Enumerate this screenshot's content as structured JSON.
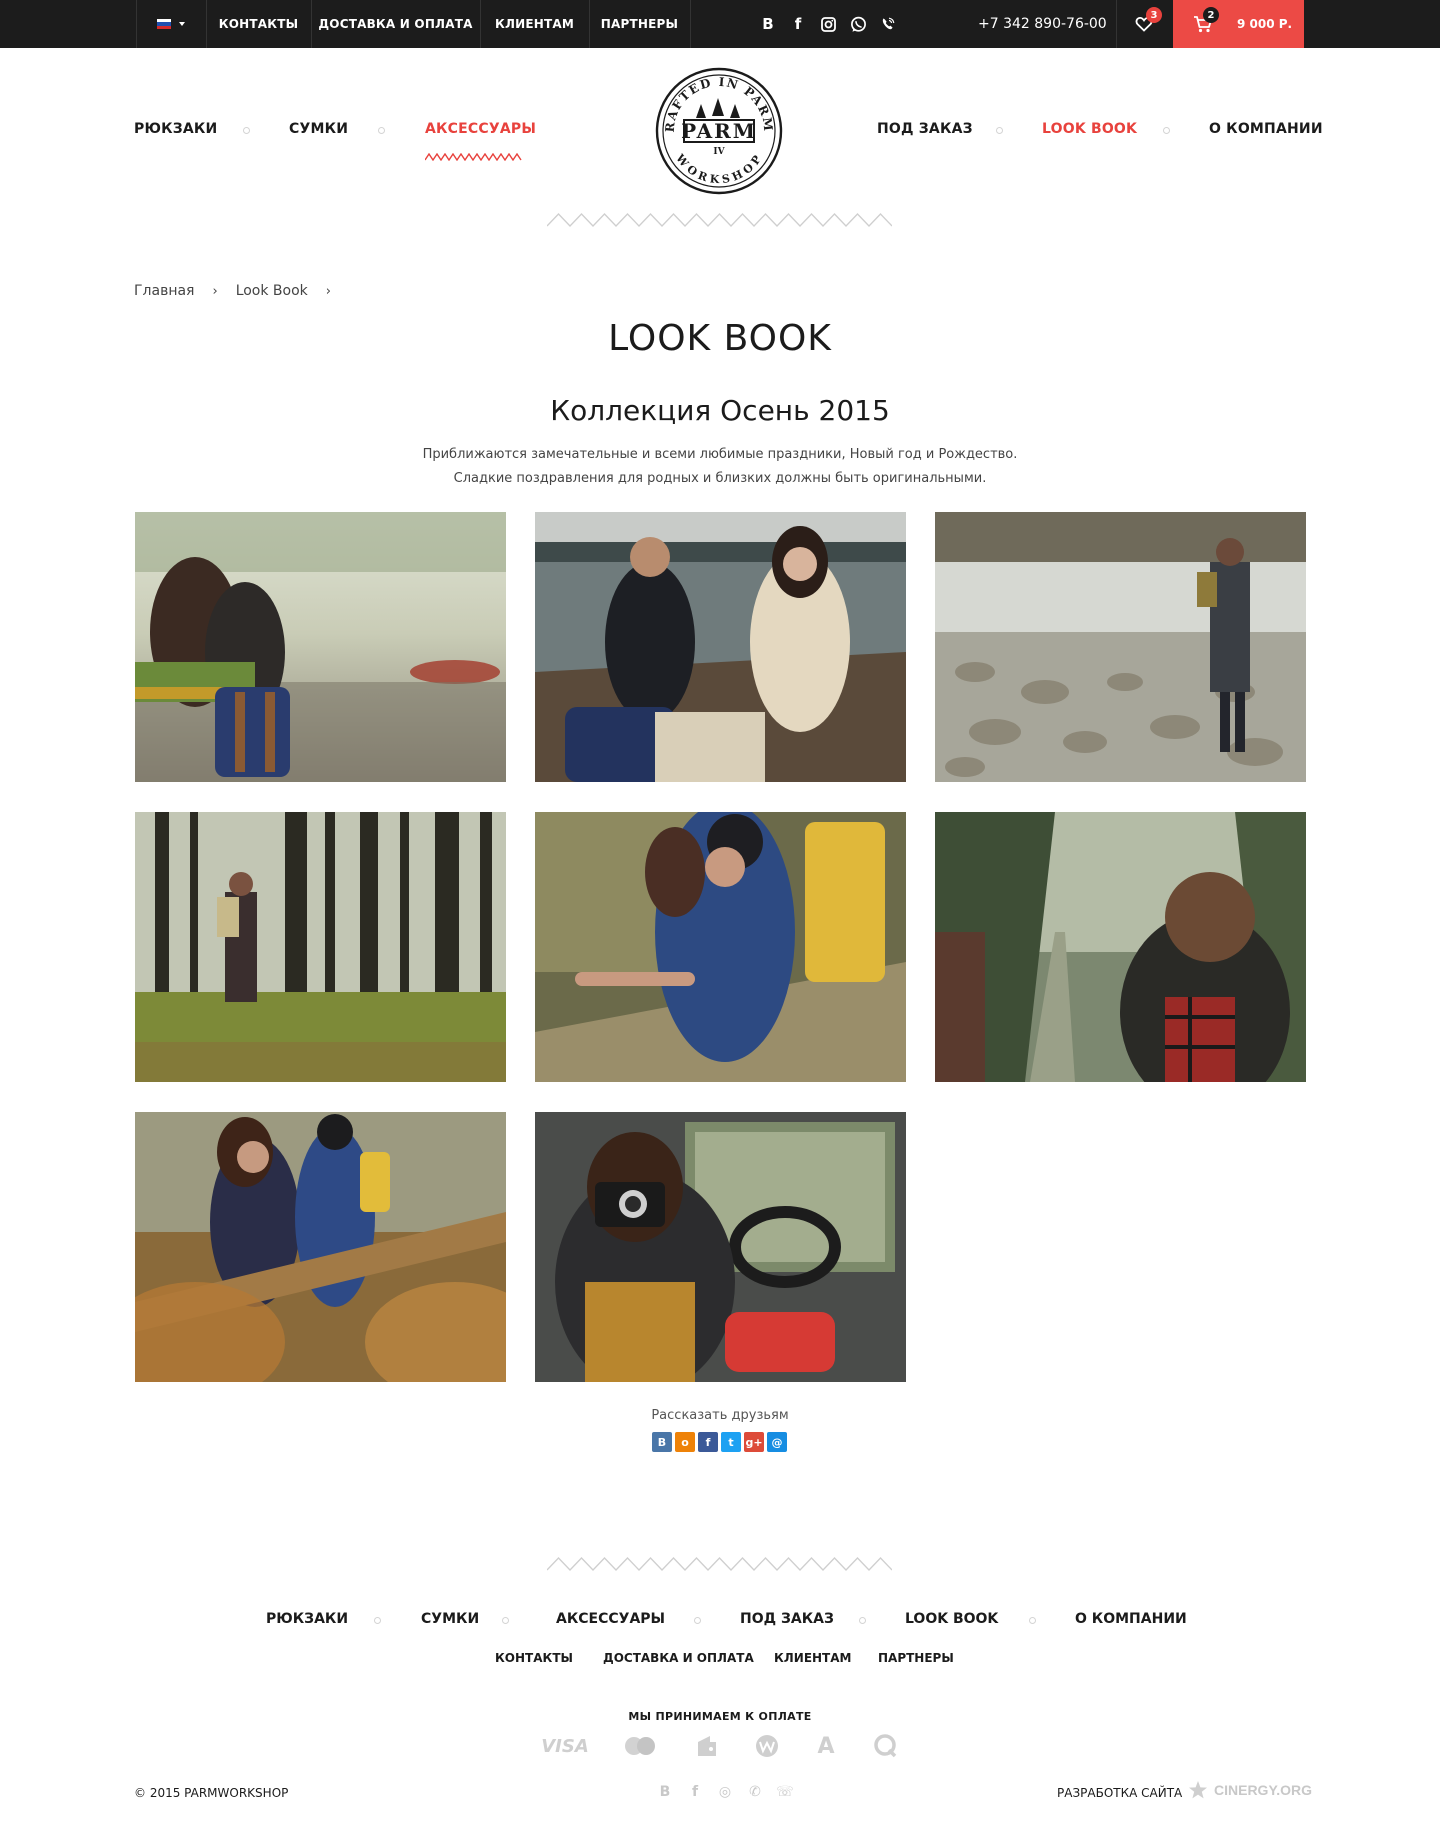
{
  "topbar": {
    "language_flag_colors": [
      "#ffffff",
      "#1f4fb0",
      "#d42a2a"
    ],
    "nav": [
      "КОНТАКТЫ",
      "ДОСТАВКА И ОПЛАТА",
      "КЛИЕНТАМ",
      "ПАРТНЕРЫ"
    ],
    "social_icons": [
      "vk-icon",
      "facebook-icon",
      "instagram-icon",
      "whatsapp-icon",
      "viber-icon"
    ],
    "social_glyphs": {
      "vk": "B",
      "facebook": "f"
    },
    "phone": "+7 342 890-76-00",
    "favorites_count": "3",
    "cart_count": "2",
    "cart_total": "9 000 Р."
  },
  "header": {
    "nav_left": [
      "РЮКЗАКИ",
      "СУМКИ",
      "АКСЕССУАРЫ"
    ],
    "nav_right": [
      "ПОД ЗАКАЗ",
      "LOOK BOOK",
      "О КОМПАНИИ"
    ],
    "logo": {
      "top_text": "CRAFTED IN PARMA",
      "brand": "PARM",
      "numeral": "IV",
      "bottom_text": "WORKSHOP"
    },
    "accent": "#e8423d"
  },
  "breadcrumb": [
    "Главная",
    "Look Book"
  ],
  "breadcrumb_separator": "›",
  "page_title": "LOOK BOOK",
  "collection": {
    "title": "Коллекция Осень 2015",
    "intro": [
      "Приближаются замечательные и всеми любимые праздники, Новый год и Рождество.",
      "Сладкие поздравления для родных и близких должны быть оригинальными."
    ]
  },
  "gallery_count": 8,
  "share": {
    "label": "Рассказать друзьям",
    "buttons": [
      {
        "glyph": "B",
        "color": "#4a76a8"
      },
      {
        "glyph": "o",
        "color": "#ee8208"
      },
      {
        "glyph": "f",
        "color": "#3b5998"
      },
      {
        "glyph": "t",
        "color": "#1da1f2"
      },
      {
        "glyph": "g+",
        "color": "#dd4b39"
      },
      {
        "glyph": "@",
        "color": "#168de2"
      }
    ]
  },
  "footer": {
    "nav": [
      "РЮКЗАКИ",
      "СУМКИ",
      "АКСЕССУАРЫ",
      "ПОД ЗАКАЗ",
      "LOOK BOOK",
      "О КОМПАНИИ"
    ],
    "subnav": [
      "КОНТАКТЫ",
      "ДОСТАВКА И ОПЛАТА",
      "КЛИЕНТАМ",
      "ПАРТНЕРЫ"
    ],
    "payment_label": "МЫ ПРИНИМАЕМ К ОПЛАТЕ",
    "payment_icons": [
      "visa-icon",
      "mastercard-icon",
      "yandex-money-icon",
      "webmoney-icon",
      "alfa-bank-icon",
      "qiwi-icon"
    ],
    "payment_visa_text": "VISA",
    "payment_alfa_text": "A",
    "copyright": "© 2015 PARMWORKSHOP",
    "social_glyphs": [
      "B",
      "f",
      "◎",
      "✆",
      "☏"
    ],
    "dev_label": "РАЗРАБОТКА САЙТА",
    "dev_brand": "CINERGY.ORG"
  }
}
